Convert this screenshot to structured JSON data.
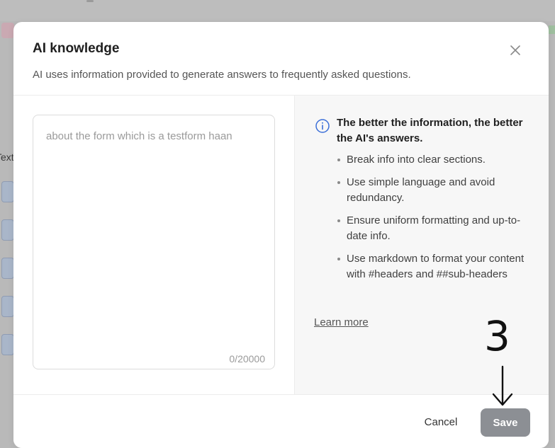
{
  "modal": {
    "title": "AI knowledge",
    "subtitle": "AI uses information provided to generate answers to frequently asked questions.",
    "close_icon": "close-icon"
  },
  "knowledge_input": {
    "value": "about the form which is a testform haan",
    "char_count": "0/20000"
  },
  "tips": {
    "icon": "info-icon",
    "heading": "The better the information, the better the AI's answers.",
    "items": [
      "Break info into clear sections.",
      "Use simple language and avoid redundancy.",
      "Ensure uniform formatting and up-to-date info.",
      "Use markdown to format your content with #headers and ##sub-headers"
    ],
    "learn_more": "Learn more"
  },
  "footer": {
    "cancel_label": "Cancel",
    "save_label": "Save"
  },
  "annotation": {
    "step_number": "3",
    "arrow_icon": "arrow-down-icon"
  },
  "background": {
    "side_label": "Text"
  },
  "colors": {
    "save_button_bg": "#8c8f94",
    "overlay": "#b9b9b9",
    "tips_pane_bg": "#f7f7f7"
  }
}
